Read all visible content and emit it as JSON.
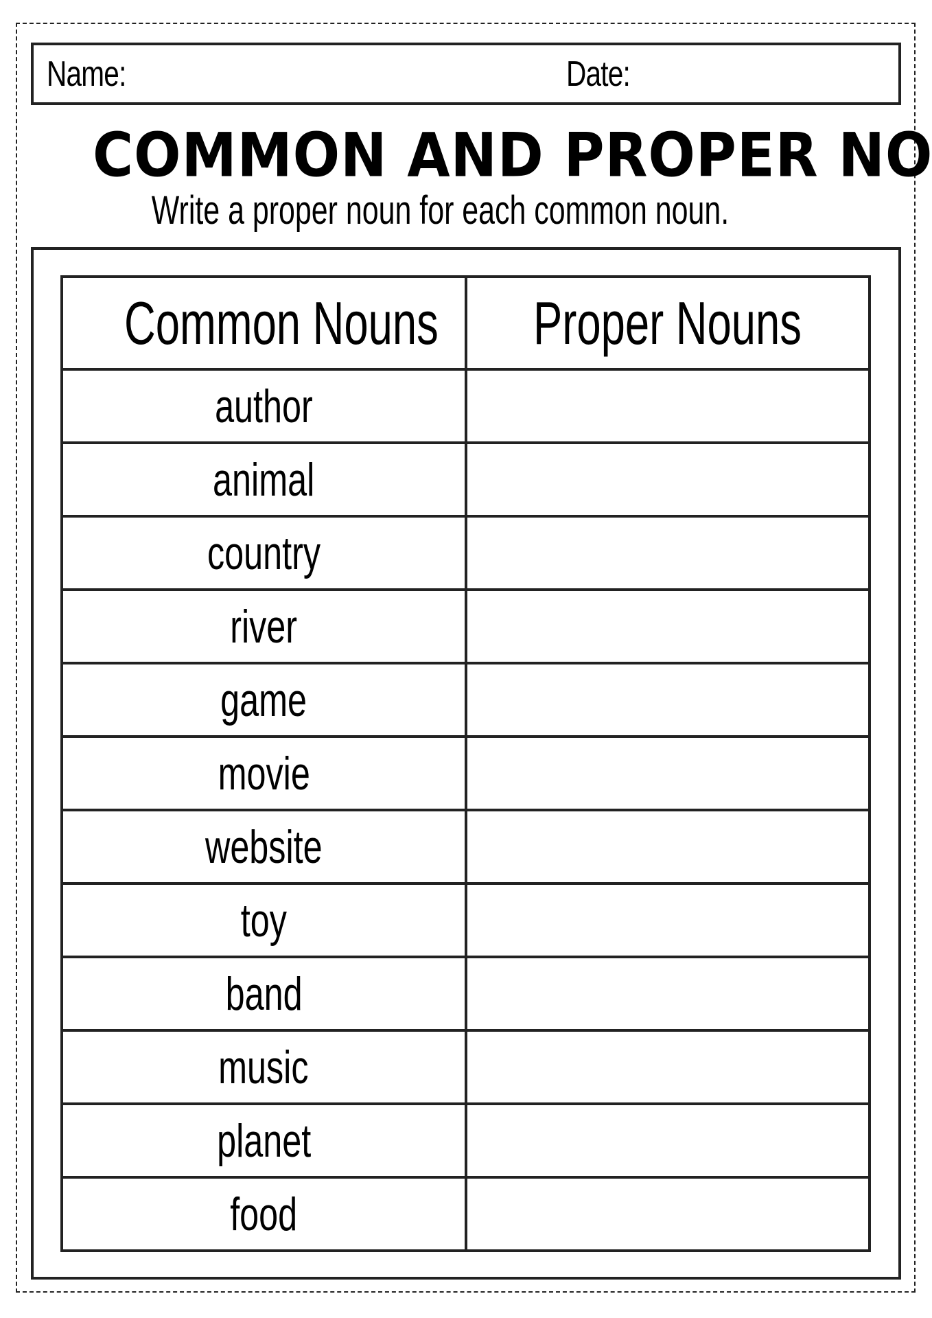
{
  "header": {
    "name_label": "Name:",
    "date_label": "Date:"
  },
  "title": "COMMON AND PROPER NOUNS",
  "instruction": "Write a proper noun for each common noun.",
  "table": {
    "columns": [
      "Common Nouns",
      "Proper Nouns"
    ],
    "rows": [
      {
        "common": "author",
        "proper": ""
      },
      {
        "common": "animal",
        "proper": ""
      },
      {
        "common": "country",
        "proper": ""
      },
      {
        "common": "river",
        "proper": ""
      },
      {
        "common": "game",
        "proper": ""
      },
      {
        "common": "movie",
        "proper": ""
      },
      {
        "common": "website",
        "proper": ""
      },
      {
        "common": "toy",
        "proper": ""
      },
      {
        "common": "band",
        "proper": ""
      },
      {
        "common": "music",
        "proper": ""
      },
      {
        "common": "planet",
        "proper": ""
      },
      {
        "common": "food",
        "proper": ""
      }
    ]
  }
}
